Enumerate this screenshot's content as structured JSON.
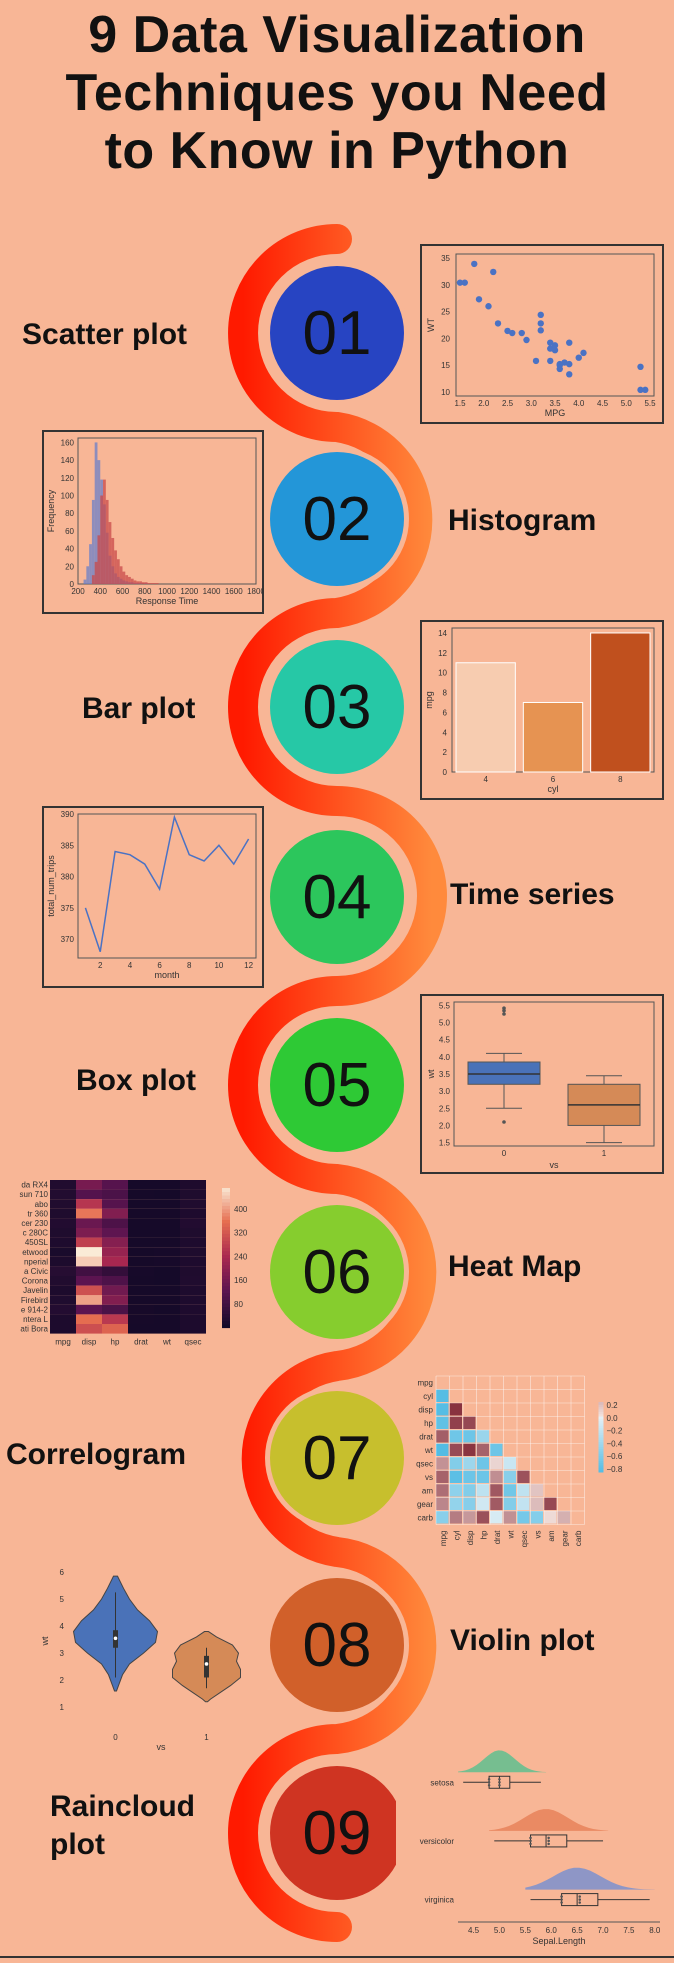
{
  "title_lines": [
    "9 Data Visualization",
    "Techniques you Need",
    "to Know in Python"
  ],
  "colors": {
    "background": "#f8b696",
    "snake_start": "#ff1a00",
    "snake_end": "#ff8a3c",
    "circle_01": "#2744c2",
    "circle_02": "#2396d8",
    "circle_03": "#26c8a6",
    "circle_04": "#2cc65c",
    "circle_05": "#2ec935",
    "circle_06": "#86cd2e",
    "circle_07": "#c7bf2d",
    "circle_08": "#d1602a",
    "circle_09": "#cf3422"
  },
  "steps": [
    {
      "number": "01",
      "label": "Scatter plot"
    },
    {
      "number": "02",
      "label": "Histogram"
    },
    {
      "number": "03",
      "label": "Bar plot"
    },
    {
      "number": "04",
      "label": "Time series"
    },
    {
      "number": "05",
      "label": "Box plot"
    },
    {
      "number": "06",
      "label": "Heat Map"
    },
    {
      "number": "07",
      "label": "Correlogram"
    },
    {
      "number": "08",
      "label": "Violin plot"
    },
    {
      "number": "09",
      "label": "Raincloud plot"
    }
  ],
  "chart_data": [
    {
      "type": "scatter",
      "xlabel": "MPG",
      "ylabel": "WT",
      "xticks": [
        "1.5",
        "2.0",
        "2.5",
        "3.0",
        "3.5",
        "4.0",
        "4.5",
        "5.0",
        "5.5"
      ],
      "yticks": [
        "10",
        "15",
        "20",
        "25",
        "30",
        "35"
      ],
      "xlim": [
        1.5,
        5.5
      ],
      "ylim": [
        10,
        35
      ],
      "points": [
        [
          1.5,
          30.4
        ],
        [
          1.6,
          30.4
        ],
        [
          1.8,
          33.9
        ],
        [
          1.9,
          27.3
        ],
        [
          2.1,
          26
        ],
        [
          2.2,
          32.4
        ],
        [
          2.3,
          22.8
        ],
        [
          2.5,
          21.4
        ],
        [
          2.6,
          21
        ],
        [
          2.8,
          21
        ],
        [
          2.9,
          19.7
        ],
        [
          3.2,
          22.8
        ],
        [
          3.2,
          24.4
        ],
        [
          3.2,
          21.5
        ],
        [
          3.4,
          19.2
        ],
        [
          3.4,
          18.1
        ],
        [
          3.5,
          17.8
        ],
        [
          3.5,
          18.7
        ],
        [
          3.4,
          15.8
        ],
        [
          3.6,
          15.2
        ],
        [
          3.7,
          15.5
        ],
        [
          3.8,
          15.2
        ],
        [
          3.8,
          13.3
        ],
        [
          3.8,
          19.2
        ],
        [
          4.0,
          16.4
        ],
        [
          4.1,
          17.3
        ],
        [
          5.3,
          10.4
        ],
        [
          5.4,
          10.4
        ],
        [
          5.3,
          14.7
        ],
        [
          3.6,
          15.0
        ],
        [
          3.1,
          15.8
        ],
        [
          3.6,
          14.3
        ]
      ]
    },
    {
      "type": "bar",
      "xlabel": "Response Time",
      "ylabel": "Frequency",
      "xticks": [
        "200",
        "400",
        "600",
        "800",
        "1000",
        "1200",
        "1400",
        "1600",
        "1800"
      ],
      "yticks": [
        "0",
        "20",
        "40",
        "60",
        "80",
        "100",
        "120",
        "140",
        "160"
      ],
      "xlim": [
        200,
        1800
      ],
      "ylim": [
        0,
        165
      ],
      "bin_width": 25,
      "series": [
        {
          "values": [
            0,
            0,
            5,
            20,
            45,
            95,
            160,
            140,
            118,
            90,
            58,
            32,
            20,
            12,
            8,
            6,
            4,
            3,
            2,
            2,
            1,
            1,
            1,
            0,
            1,
            0,
            0,
            0,
            0,
            0,
            0,
            0,
            0,
            0,
            0,
            0,
            0,
            0,
            0,
            0,
            0,
            0,
            0,
            0,
            0,
            0,
            0,
            0,
            0,
            0,
            0,
            0,
            0,
            0,
            0,
            0,
            0,
            0,
            0,
            0,
            0,
            0,
            0,
            0
          ],
          "color": "#6a7fc8"
        },
        {
          "values": [
            0,
            0,
            0,
            0,
            0,
            10,
            25,
            55,
            100,
            118,
            95,
            70,
            52,
            38,
            28,
            20,
            14,
            10,
            8,
            6,
            4,
            3,
            3,
            2,
            2,
            1,
            1,
            1,
            1,
            0,
            0,
            0,
            0,
            0,
            0,
            0,
            0,
            0,
            0,
            0,
            0,
            0,
            0,
            0,
            0,
            0,
            0,
            0,
            0,
            0,
            0,
            0,
            0,
            0,
            0,
            0,
            0,
            0,
            0,
            0,
            0,
            0,
            0,
            0
          ],
          "color": "#c94a4a"
        }
      ]
    },
    {
      "type": "bar",
      "xlabel": "cyl",
      "ylabel": "mpg",
      "categories": [
        "4",
        "6",
        "8"
      ],
      "values": [
        11,
        7,
        14
      ],
      "bar_colors": [
        "#f7ccb0",
        "#e69352",
        "#c0501e"
      ],
      "yticks": [
        "0",
        "2",
        "4",
        "6",
        "8",
        "10",
        "12",
        "14"
      ],
      "ylim": [
        0,
        14.5
      ]
    },
    {
      "type": "line",
      "xlabel": "month",
      "ylabel": "total_num_trips",
      "x": [
        1,
        2,
        3,
        4,
        5,
        6,
        7,
        8,
        9,
        10,
        11,
        12
      ],
      "y": [
        375,
        368,
        384,
        383.5,
        382,
        378,
        389.5,
        383.5,
        382.5,
        385,
        382,
        386
      ],
      "xticks": [
        "2",
        "4",
        "6",
        "8",
        "10",
        "12"
      ],
      "yticks": [
        "370",
        "375",
        "380",
        "385",
        "390"
      ],
      "xlim": [
        0.5,
        12.5
      ],
      "ylim": [
        367,
        390
      ]
    },
    {
      "type": "box",
      "xlabel": "vs",
      "ylabel": "wt",
      "categories": [
        "0",
        "1"
      ],
      "boxes": [
        {
          "whisker_low": 2.5,
          "q1": 3.2,
          "median": 3.5,
          "q3": 3.85,
          "whisker_high": 4.1,
          "outliers": [
            5.25,
            5.35,
            5.42,
            2.1
          ],
          "color": "#4a72b8"
        },
        {
          "whisker_low": 1.5,
          "q1": 2.0,
          "median": 2.6,
          "q3": 3.2,
          "whisker_high": 3.45,
          "outliers": [],
          "color": "#d58a57"
        }
      ],
      "yticks": [
        "1.5",
        "2.0",
        "2.5",
        "3.0",
        "3.5",
        "4.0",
        "4.5",
        "5.0",
        "5.5"
      ],
      "ylim": [
        1.4,
        5.6
      ]
    },
    {
      "type": "heatmap",
      "row_labels": [
        "da RX4",
        "sun 710",
        "abo",
        "tr 360",
        "cer 230",
        "c 280C",
        "450SL",
        "etwood",
        "nperial",
        "a Civic",
        "Corona",
        "Javelin",
        "Firebird",
        "e 914-2",
        "ntera L",
        "ati Bora"
      ],
      "col_labels": [
        "mpg",
        "disp",
        "hp",
        "drat",
        "wt",
        "qsec"
      ],
      "colorbar_ticks": [
        "400",
        "320",
        "240",
        "160",
        "80"
      ],
      "values": [
        [
          21,
          160,
          110,
          3.9,
          2.6,
          16
        ],
        [
          22.8,
          108,
          93,
          3.8,
          2.3,
          18.6
        ],
        [
          21.4,
          258,
          110,
          3.1,
          3.2,
          19.4
        ],
        [
          18.7,
          360,
          175,
          3.2,
          3.4,
          17
        ],
        [
          22.8,
          140.8,
          95,
          3.9,
          3.2,
          22.9
        ],
        [
          17.8,
          167.6,
          123,
          3.9,
          3.4,
          18.9
        ],
        [
          17.3,
          275.8,
          180,
          3.1,
          3.7,
          17.6
        ],
        [
          10.4,
          472,
          205,
          2.9,
          5.2,
          18
        ],
        [
          14.7,
          440,
          230,
          3.2,
          5.3,
          17.4
        ],
        [
          30.4,
          75.7,
          52,
          4.9,
          1.6,
          18.5
        ],
        [
          21.5,
          120.1,
          97,
          3.7,
          2.5,
          20
        ],
        [
          15.2,
          304,
          150,
          3.2,
          3.4,
          17.3
        ],
        [
          19.2,
          400,
          175,
          3.1,
          3.8,
          17
        ],
        [
          26,
          120.3,
          91,
          4.4,
          2.1,
          16.7
        ],
        [
          15.8,
          351,
          264,
          4.2,
          3.2,
          14.5
        ],
        [
          15,
          301,
          335,
          3.5,
          3.6,
          14.6
        ]
      ]
    },
    {
      "type": "heatmap",
      "labels": [
        "mpg",
        "cyl",
        "disp",
        "hp",
        "drat",
        "wt",
        "qsec",
        "vs",
        "am",
        "gear",
        "carb"
      ],
      "colorbar_ticks": [
        "0.2",
        "0.0",
        "−0.2",
        "−0.4",
        "−0.6",
        "−0.8"
      ],
      "matrix": [
        [
          0,
          0,
          0,
          0,
          0,
          0,
          0,
          0,
          0,
          0,
          0
        ],
        [
          -0.85,
          0,
          0,
          0,
          0,
          0,
          0,
          0,
          0,
          0,
          0
        ],
        [
          -0.85,
          0.9,
          0,
          0,
          0,
          0,
          0,
          0,
          0,
          0,
          0
        ],
        [
          -0.78,
          0.83,
          0.79,
          0,
          0,
          0,
          0,
          0,
          0,
          0,
          0
        ],
        [
          0.68,
          -0.7,
          -0.71,
          -0.45,
          0,
          0,
          0,
          0,
          0,
          0,
          0
        ],
        [
          -0.87,
          0.78,
          0.89,
          0.66,
          -0.71,
          0,
          0,
          0,
          0,
          0,
          0
        ],
        [
          0.42,
          -0.59,
          -0.43,
          -0.71,
          0.09,
          -0.17,
          0,
          0,
          0,
          0,
          0
        ],
        [
          0.66,
          -0.81,
          -0.71,
          -0.72,
          0.44,
          -0.55,
          0.74,
          0,
          0,
          0,
          0
        ],
        [
          0.6,
          -0.52,
          -0.59,
          -0.24,
          0.71,
          -0.69,
          -0.23,
          0.17,
          0,
          0,
          0
        ],
        [
          0.48,
          -0.49,
          -0.56,
          -0.13,
          0.7,
          -0.58,
          -0.21,
          0.21,
          0.79,
          0,
          0
        ],
        [
          -0.55,
          0.53,
          0.39,
          0.75,
          -0.09,
          0.43,
          -0.66,
          -0.57,
          0.06,
          0.27,
          0
        ]
      ]
    },
    {
      "type": "violin",
      "xlabel": "vs",
      "ylabel": "wt",
      "categories": [
        "0",
        "1"
      ],
      "colors": [
        "#4a72b8",
        "#d58a57"
      ],
      "yticks": [
        "1",
        "2",
        "3",
        "4",
        "5",
        "6"
      ],
      "ylim": [
        0.6,
        6.3
      ]
    },
    {
      "type": "raincloud",
      "xlabel": "Sepal.Length",
      "categories": [
        "setosa",
        "versicolor",
        "virginica"
      ],
      "colors": [
        "#5fbf8f",
        "#e8835a",
        "#7b91cf"
      ],
      "xticks": [
        "4.5",
        "5.0",
        "5.5",
        "6.0",
        "6.5",
        "7.0",
        "7.5",
        "8.0"
      ],
      "xlim": [
        4.2,
        8.1
      ],
      "boxes": [
        {
          "low": 4.3,
          "q1": 4.8,
          "median": 5.0,
          "q3": 5.2,
          "high": 5.8
        },
        {
          "low": 4.9,
          "q1": 5.6,
          "median": 5.9,
          "q3": 6.3,
          "high": 7.0
        },
        {
          "low": 5.6,
          "q1": 6.2,
          "median": 6.5,
          "q3": 6.9,
          "high": 7.9
        }
      ]
    }
  ]
}
